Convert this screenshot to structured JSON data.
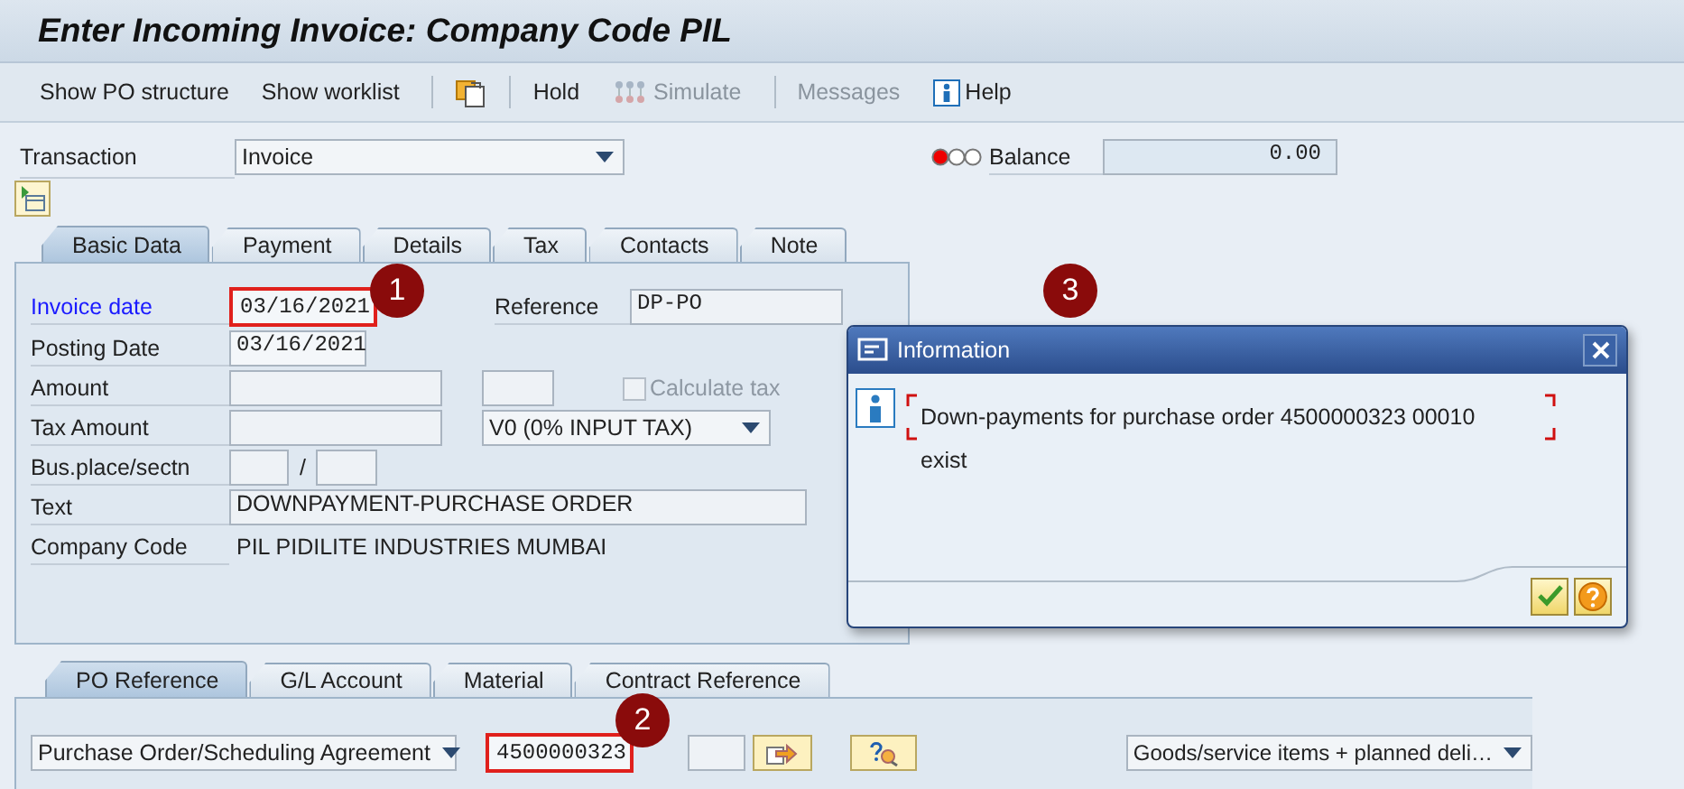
{
  "window": {
    "title": "Enter Incoming Invoice: Company Code PIL"
  },
  "toolbar": [
    {
      "kind": "text",
      "label": "Show PO structure",
      "disabled": false
    },
    {
      "kind": "text",
      "label": "Show worklist",
      "disabled": false
    },
    {
      "kind": "separator"
    },
    {
      "kind": "paste"
    },
    {
      "kind": "separator"
    },
    {
      "kind": "text",
      "label": "Hold",
      "disabled": false
    },
    {
      "kind": "simulate",
      "label": "Simulate",
      "disabled": true
    },
    {
      "kind": "separator"
    },
    {
      "kind": "text",
      "label": "Messages",
      "disabled": true
    },
    {
      "kind": "help",
      "label": "Help",
      "disabled": false
    }
  ],
  "transaction": {
    "label": "Transaction",
    "value": "Invoice"
  },
  "balance": {
    "error": true,
    "label": "Balance",
    "value": "0.00"
  },
  "header_tabs": [
    {
      "label": "Basic Data",
      "selected": true
    },
    {
      "label": "Payment",
      "selected": false
    },
    {
      "label": "Details",
      "selected": false
    },
    {
      "label": "Tax",
      "selected": false
    },
    {
      "label": "Contacts",
      "selected": false
    },
    {
      "label": "Note",
      "selected": false
    }
  ],
  "basic_data": {
    "invoice_date": {
      "label": "Invoice date",
      "value": "03/16/2021",
      "required": true,
      "highlighted": true
    },
    "reference": {
      "label": "Reference",
      "value": "DP-PO"
    },
    "posting_date": {
      "label": "Posting Date",
      "value": "03/16/2021"
    },
    "amount": {
      "label": "Amount"
    },
    "calculate_tax": {
      "label": "Calculate tax",
      "checked": false,
      "disabled": true
    },
    "tax_amount": {
      "label": "Tax Amount"
    },
    "tax_code": {
      "value": "V0 (0% INPUT TAX)"
    },
    "bus_place": {
      "label": "Bus.place/sectn",
      "separator": "/"
    },
    "text": {
      "label": "Text",
      "value": "DOWNPAYMENT-PURCHASE ORDER"
    },
    "company_code": {
      "label": "Company Code",
      "value": "PIL PIDILITE INDUSTRIES MUMBAI"
    }
  },
  "dialog": {
    "title": "Information",
    "lines": [
      "Down-payments for purchase order 4500000323 00010",
      "exist"
    ],
    "buttons": [
      {
        "kind": "confirm"
      },
      {
        "kind": "help"
      }
    ]
  },
  "po_tabs": [
    {
      "label": "PO Reference",
      "selected": true
    },
    {
      "label": "G/L Account",
      "selected": false
    },
    {
      "label": "Material",
      "selected": false
    },
    {
      "label": "Contract Reference",
      "selected": false
    }
  ],
  "po_reference": {
    "document_type": "Purchase Order/Scheduling Agreement",
    "po_number": "4500000323",
    "highlighted": true,
    "item_selection": "Goods/service items + planned deli…"
  },
  "callouts": [
    {
      "number": "1"
    },
    {
      "number": "2"
    },
    {
      "number": "3"
    }
  ]
}
